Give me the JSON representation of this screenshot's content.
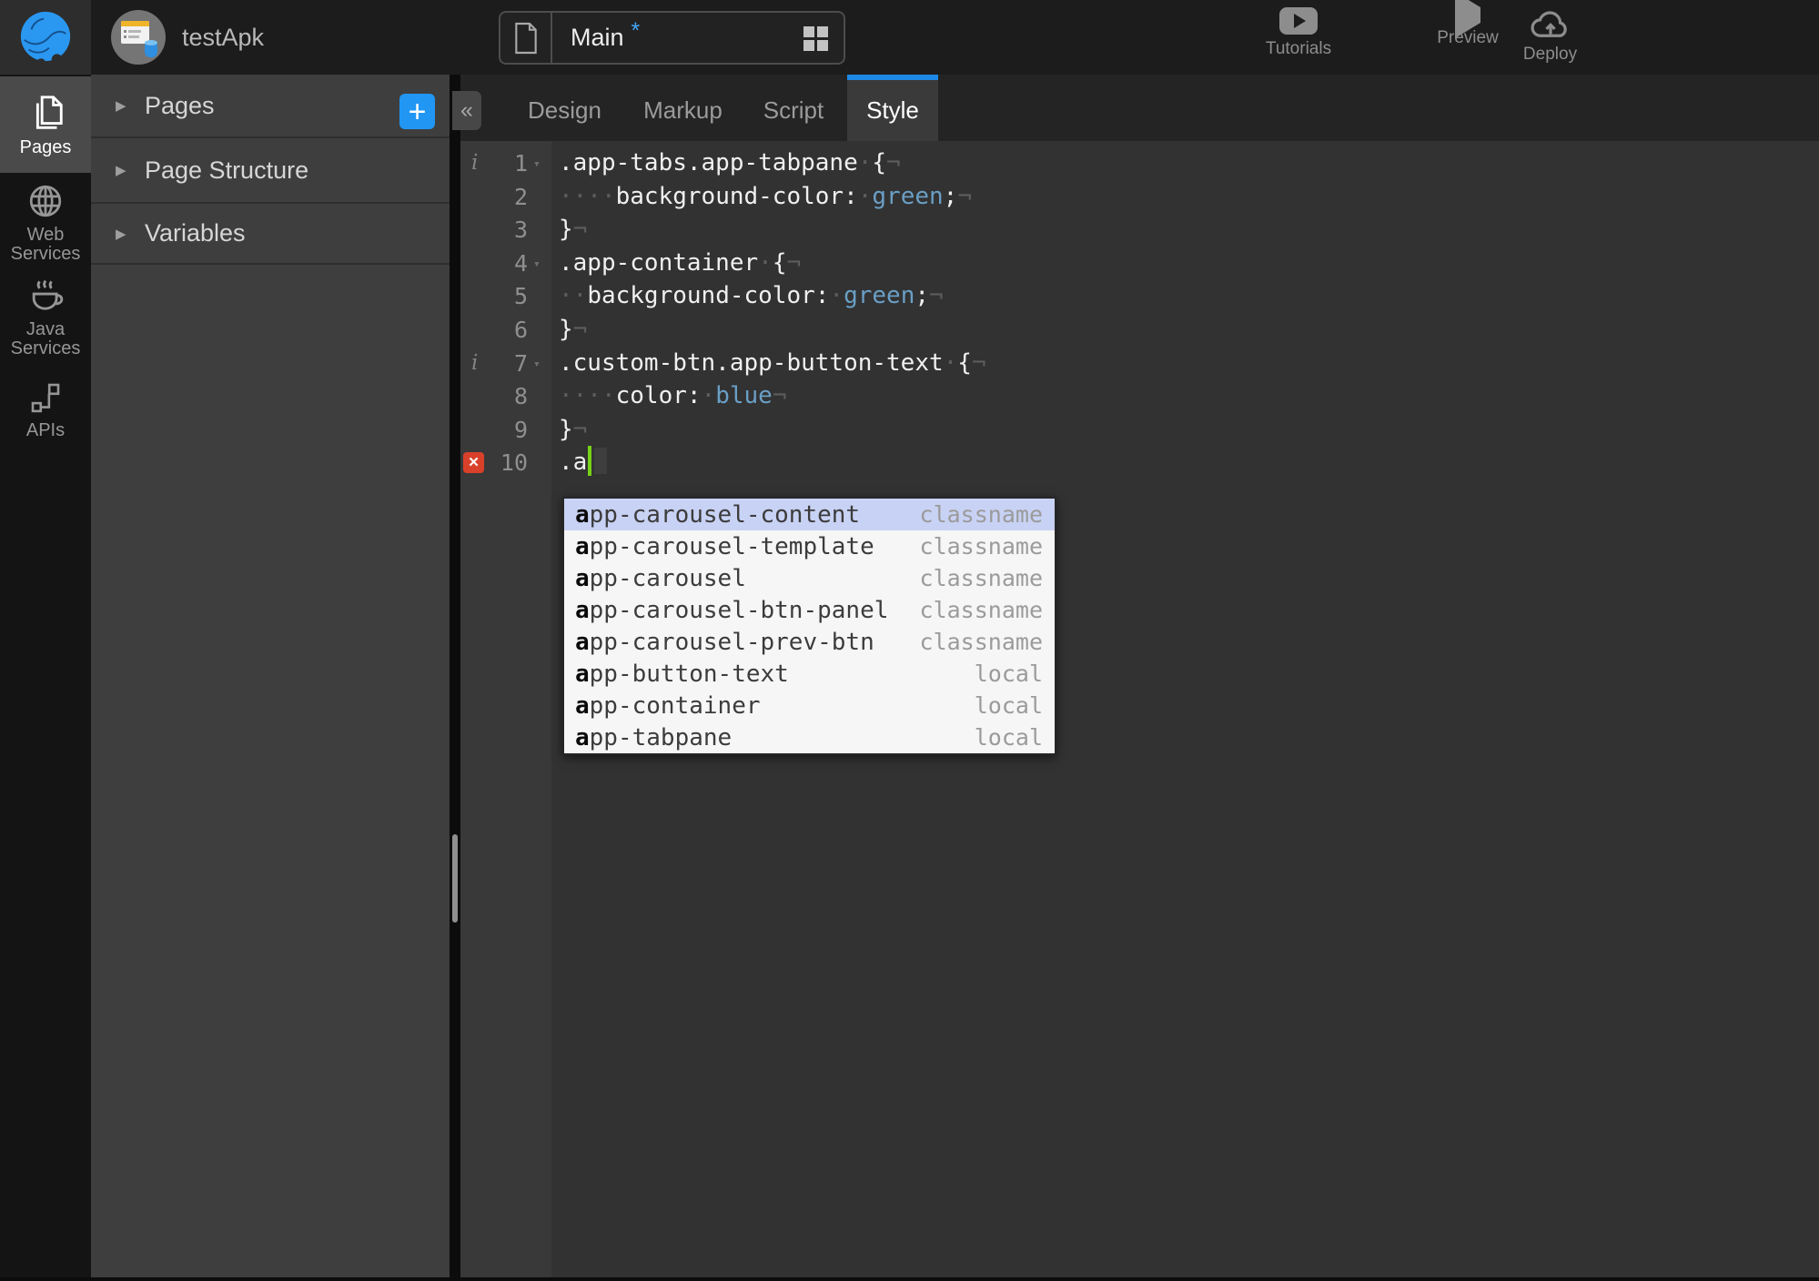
{
  "colors": {
    "accent_blue": "#2196f3",
    "tab_underline_blue": "#1e88e5",
    "cursor_green": "#76d216",
    "error_red": "#d9402a",
    "css_value_blue": "#6a9fc5",
    "autocomplete_selection": "#c8d2f4"
  },
  "topbar": {
    "project_name": "testApk",
    "page_tab": {
      "name": "Main",
      "dirty": "*"
    },
    "actions": [
      {
        "id": "tutorials",
        "label": "Tutorials",
        "icon": "youtube-icon"
      },
      {
        "id": "preview",
        "label": "Preview",
        "icon": "play-icon"
      },
      {
        "id": "deploy",
        "label": "Deploy",
        "icon": "cloud-upload-icon"
      }
    ]
  },
  "rail": {
    "items": [
      {
        "id": "pages",
        "label": "Pages",
        "icon": "pages-icon",
        "active": true
      },
      {
        "id": "web-services",
        "label": "Web Services",
        "icon": "globe-icon",
        "active": false
      },
      {
        "id": "java-services",
        "label": "Java Services",
        "icon": "coffee-icon",
        "active": false
      },
      {
        "id": "apis",
        "label": "APIs",
        "icon": "flow-icon",
        "active": false
      }
    ]
  },
  "panel": {
    "sections": [
      {
        "label": "Pages",
        "add_button": true
      },
      {
        "label": "Page Structure",
        "add_button": false
      },
      {
        "label": "Variables",
        "add_button": false
      }
    ],
    "add_glyph": "+",
    "collapse_glyph": "«",
    "expand_arrow": "▶"
  },
  "editor": {
    "tabs": [
      {
        "label": "Design",
        "active": false
      },
      {
        "label": "Markup",
        "active": false
      },
      {
        "label": "Script",
        "active": false
      },
      {
        "label": "Style",
        "active": true
      }
    ],
    "gutter": {
      "info_glyph": "i",
      "fold_glyph": "▾",
      "error_glyph": "✕"
    },
    "lines": [
      {
        "num": 1,
        "info": true,
        "fold": true,
        "error": false,
        "cursor": false,
        "segs": [
          [
            "code",
            ".app-tabs.app-tabpane"
          ],
          [
            "ws",
            "·"
          ],
          [
            "code",
            "{"
          ],
          [
            "eol",
            "¬"
          ]
        ]
      },
      {
        "num": 2,
        "info": false,
        "fold": false,
        "error": false,
        "cursor": false,
        "segs": [
          [
            "ws",
            "····"
          ],
          [
            "code",
            "background-color:"
          ],
          [
            "ws",
            "·"
          ],
          [
            "val",
            "green"
          ],
          [
            "code",
            ";"
          ],
          [
            "eol",
            "¬"
          ]
        ]
      },
      {
        "num": 3,
        "info": false,
        "fold": false,
        "error": false,
        "cursor": false,
        "segs": [
          [
            "code",
            "}"
          ],
          [
            "eol",
            "¬"
          ]
        ]
      },
      {
        "num": 4,
        "info": false,
        "fold": true,
        "error": false,
        "cursor": false,
        "segs": [
          [
            "code",
            ".app-container"
          ],
          [
            "ws",
            "·"
          ],
          [
            "code",
            "{"
          ],
          [
            "eol",
            "¬"
          ]
        ]
      },
      {
        "num": 5,
        "info": false,
        "fold": false,
        "error": false,
        "cursor": false,
        "segs": [
          [
            "ws",
            "··"
          ],
          [
            "code",
            "background-color:"
          ],
          [
            "ws",
            "·"
          ],
          [
            "val",
            "green"
          ],
          [
            "code",
            ";"
          ],
          [
            "eol",
            "¬"
          ]
        ]
      },
      {
        "num": 6,
        "info": false,
        "fold": false,
        "error": false,
        "cursor": false,
        "segs": [
          [
            "code",
            "}"
          ],
          [
            "eol",
            "¬"
          ]
        ]
      },
      {
        "num": 7,
        "info": true,
        "fold": true,
        "error": false,
        "cursor": false,
        "segs": [
          [
            "code",
            ".custom-btn.app-button-text"
          ],
          [
            "ws",
            "·"
          ],
          [
            "code",
            "{"
          ],
          [
            "eol",
            "¬"
          ]
        ]
      },
      {
        "num": 8,
        "info": false,
        "fold": false,
        "error": false,
        "cursor": false,
        "segs": [
          [
            "ws",
            "····"
          ],
          [
            "code",
            "color:"
          ],
          [
            "ws",
            "·"
          ],
          [
            "val",
            "blue"
          ],
          [
            "eol",
            "¬"
          ]
        ]
      },
      {
        "num": 9,
        "info": false,
        "fold": false,
        "error": false,
        "cursor": false,
        "segs": [
          [
            "code",
            "}"
          ],
          [
            "eol",
            "¬"
          ]
        ]
      },
      {
        "num": 10,
        "info": false,
        "fold": false,
        "error": true,
        "cursor": true,
        "segs": [
          [
            "code",
            ".a"
          ]
        ]
      }
    ],
    "autocomplete": {
      "items": [
        {
          "prefix": "a",
          "rest": "pp-carousel-content",
          "meta": "classname",
          "selected": true
        },
        {
          "prefix": "a",
          "rest": "pp-carousel-template",
          "meta": "classname",
          "selected": false
        },
        {
          "prefix": "a",
          "rest": "pp-carousel",
          "meta": "classname",
          "selected": false
        },
        {
          "prefix": "a",
          "rest": "pp-carousel-btn-panel",
          "meta": "classname",
          "selected": false
        },
        {
          "prefix": "a",
          "rest": "pp-carousel-prev-btn",
          "meta": "classname",
          "selected": false
        },
        {
          "prefix": "a",
          "rest": "pp-button-text",
          "meta": "local",
          "selected": false
        },
        {
          "prefix": "a",
          "rest": "pp-container",
          "meta": "local",
          "selected": false
        },
        {
          "prefix": "a",
          "rest": "pp-tabpane",
          "meta": "local",
          "selected": false
        }
      ]
    }
  }
}
